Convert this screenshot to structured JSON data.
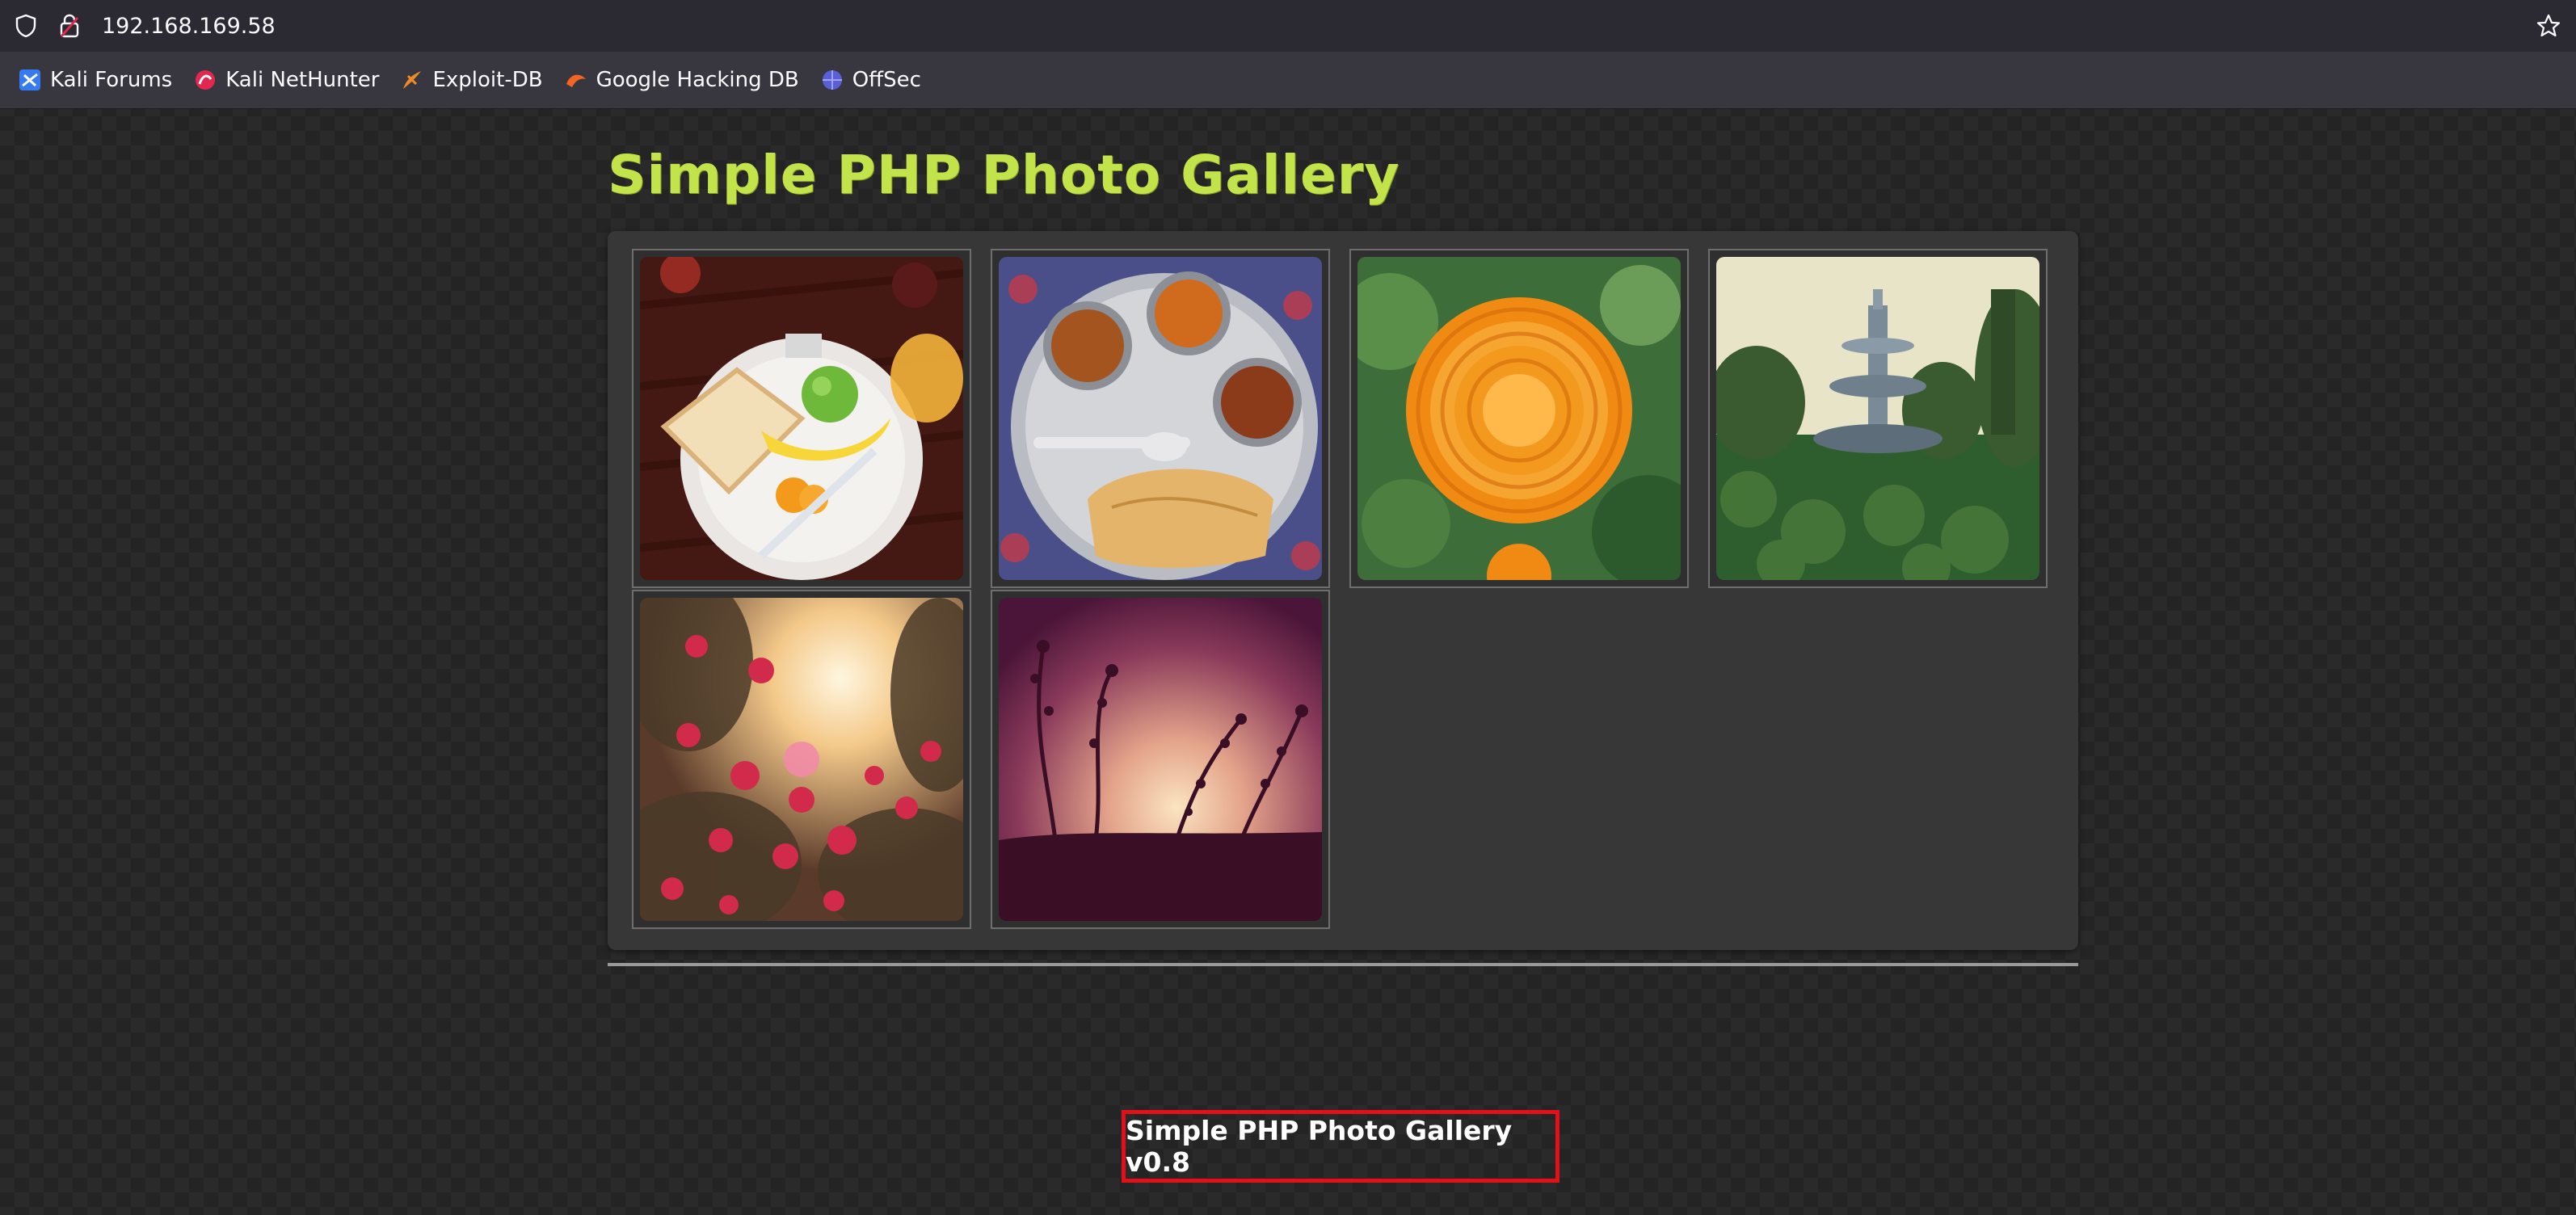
{
  "browser": {
    "url": "192.168.169.58",
    "bookmarks": [
      {
        "label": "Kali Forums",
        "icon": "kali-forums-icon"
      },
      {
        "label": "Kali NetHunter",
        "icon": "kali-nethunter-icon"
      },
      {
        "label": "Exploit-DB",
        "icon": "exploit-db-icon"
      },
      {
        "label": "Google Hacking DB",
        "icon": "google-hacking-db-icon"
      },
      {
        "label": "OffSec",
        "icon": "offsec-icon"
      }
    ]
  },
  "page": {
    "title": "Simple PHP Photo Gallery",
    "photos": [
      {
        "subject": "breakfast-plate"
      },
      {
        "subject": "indian-thali"
      },
      {
        "subject": "orange-marigold-flower"
      },
      {
        "subject": "garden-fountain"
      },
      {
        "subject": "red-flowers-sunset"
      },
      {
        "subject": "plant-silhouette-sunset"
      }
    ],
    "footer": "Simple PHP Photo Gallery v0.8"
  },
  "colors": {
    "title": "#c3e34b",
    "background": "#242424",
    "gallery_panel": "#373737",
    "footer_highlight": "#e3101a"
  }
}
